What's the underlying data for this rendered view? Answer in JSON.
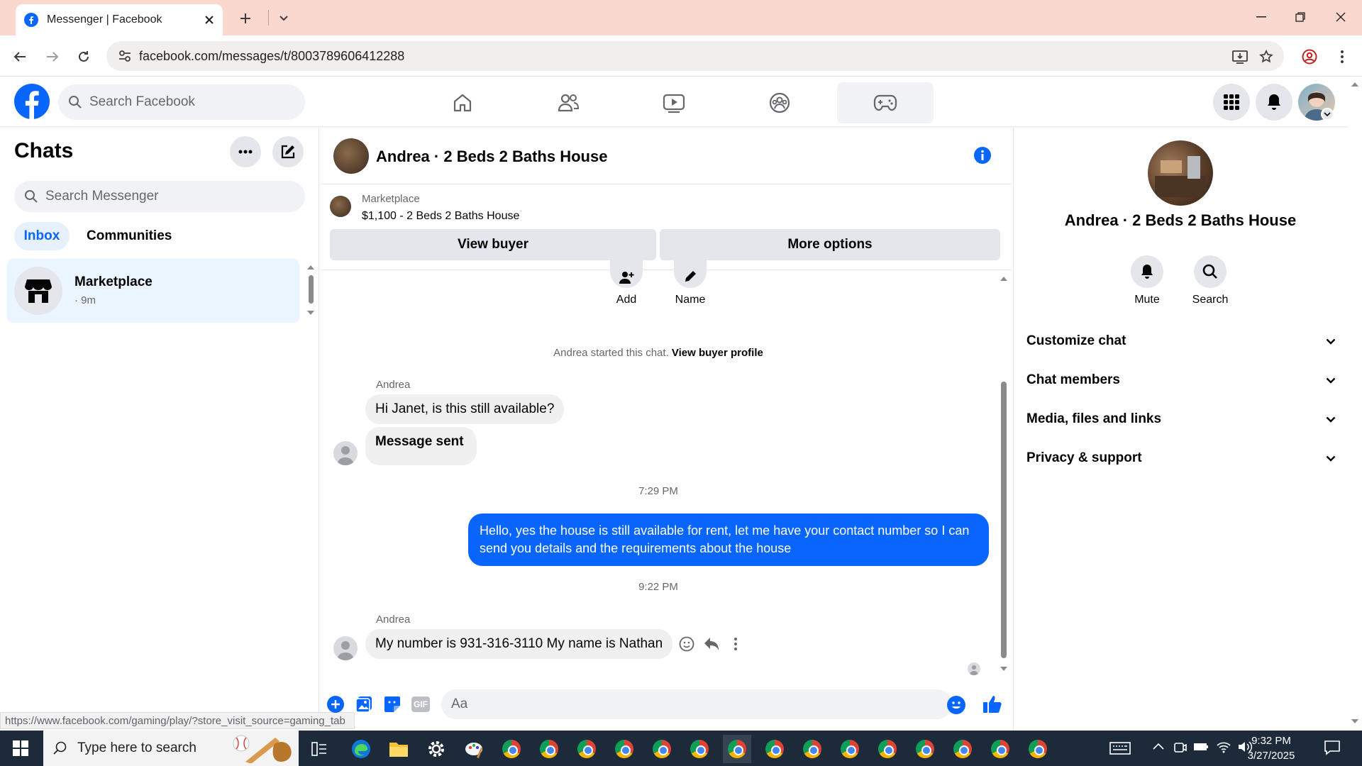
{
  "browser": {
    "tab_title": "Messenger | Facebook",
    "url": "facebook.com/messages/t/8003789606412288",
    "status_url": "https://www.facebook.com/gaming/play/?store_visit_source=gaming_tab"
  },
  "header": {
    "search_placeholder": "Search Facebook"
  },
  "left": {
    "title": "Chats",
    "search_placeholder": "Search Messenger",
    "filters": [
      "Inbox",
      "Communities"
    ],
    "chat": {
      "name": "Marketplace",
      "time": "· 9m"
    }
  },
  "conversation": {
    "name": "Andrea · 2 Beds 2 Baths House",
    "marketplace_label": "Marketplace",
    "listing": "$1,100 - 2 Beds 2 Baths House",
    "view_buyer": "View buyer",
    "more_options": "More options",
    "quick_actions": [
      "Add",
      "Name"
    ],
    "started_text": "Andrea started this chat.",
    "started_link": "View buyer profile",
    "sender1": "Andrea",
    "msg1": "Hi Janet, is this still available?",
    "msg2": "Message sent",
    "time1": "7:29 PM",
    "msg3": "Hello, yes the house is still available for rent, let me have your contact number so I can send you details and the requirements about the house",
    "time2": "9:22 PM",
    "sender2": "Andrea",
    "msg4": "My number is 931-316-3110 My name is Nathan",
    "composer_placeholder": "Aa"
  },
  "right": {
    "name": "Andrea · 2 Beds 2 Baths House",
    "actions": [
      "Mute",
      "Search"
    ],
    "sections": [
      "Customize chat",
      "Chat members",
      "Media, files and links",
      "Privacy & support"
    ]
  },
  "taskbar": {
    "search_placeholder": "Type here to search",
    "time": "9:32 PM",
    "date": "3/27/2025"
  },
  "colors": {
    "fb_blue": "#0866ff",
    "tabbar": "#fbd8cf",
    "taskbar": "#1c2a3a"
  }
}
